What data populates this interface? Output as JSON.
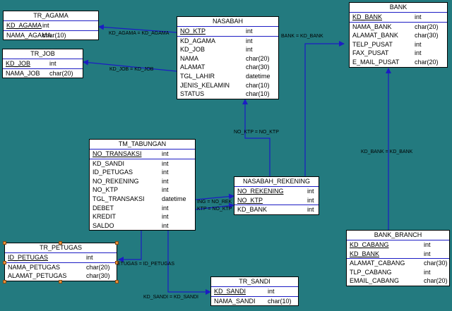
{
  "tables": {
    "tr_agama": {
      "title": "TR_AGAMA",
      "columns": [
        {
          "name": "KD_AGAMA",
          "type": "int",
          "pk": true
        },
        {
          "name": "NAMA_AGAMA",
          "type": "char(10)",
          "pk": false
        }
      ]
    },
    "tr_job": {
      "title": "TR_JOB",
      "columns": [
        {
          "name": "KD_JOB",
          "type": "int",
          "pk": true
        },
        {
          "name": "NAMA_JOB",
          "type": "char(20)",
          "pk": false
        }
      ]
    },
    "nasabah": {
      "title": "NASABAH",
      "columns": [
        {
          "name": "NO_KTP",
          "type": "int",
          "pk": true
        },
        {
          "name": "KD_AGAMA",
          "type": "int",
          "pk": false
        },
        {
          "name": "KD_JOB",
          "type": "int",
          "pk": false
        },
        {
          "name": "NAMA",
          "type": "char(20)",
          "pk": false
        },
        {
          "name": "ALAMAT",
          "type": "char(30)",
          "pk": false
        },
        {
          "name": "TGL_LAHIR",
          "type": "datetime",
          "pk": false
        },
        {
          "name": "JENIS_KELAMIN",
          "type": "char(10)",
          "pk": false
        },
        {
          "name": "STATUS",
          "type": "char(10)",
          "pk": false
        }
      ]
    },
    "bank": {
      "title": "BANK",
      "columns": [
        {
          "name": "KD_BANK",
          "type": "int",
          "pk": true
        },
        {
          "name": "NAMA_BANK",
          "type": "char(20)",
          "pk": false
        },
        {
          "name": "ALAMAT_BANK",
          "type": "char(30)",
          "pk": false
        },
        {
          "name": "TELP_PUSAT",
          "type": "int",
          "pk": false
        },
        {
          "name": "FAX_PUSAT",
          "type": "int",
          "pk": false
        },
        {
          "name": "E_MAIL_PUSAT",
          "type": "char(20)",
          "pk": false
        }
      ]
    },
    "tm_tabungan": {
      "title": "TM_TABUNGAN",
      "columns": [
        {
          "name": "NO_TRANSAKSI",
          "type": "int",
          "pk": true
        },
        {
          "name": "KD_SANDI",
          "type": "int",
          "pk": false
        },
        {
          "name": "ID_PETUGAS",
          "type": "int",
          "pk": false
        },
        {
          "name": "NO_REKENING",
          "type": "int",
          "pk": false
        },
        {
          "name": "NO_KTP",
          "type": "int",
          "pk": false
        },
        {
          "name": "TGL_TRANSAKSI",
          "type": "datetime",
          "pk": false
        },
        {
          "name": "DEBET",
          "type": "int",
          "pk": false
        },
        {
          "name": "KREDIT",
          "type": "int",
          "pk": false
        },
        {
          "name": "SALDO",
          "type": "int",
          "pk": false
        }
      ]
    },
    "nasabah_rekening": {
      "title": "NASABAH_REKENING",
      "columns": [
        {
          "name": "NO_REKENING",
          "type": "int",
          "pk": true
        },
        {
          "name": "NO_KTP",
          "type": "int",
          "pk": true
        },
        {
          "name": "KD_BANK",
          "type": "int",
          "pk": false
        }
      ]
    },
    "bank_branch": {
      "title": "BANK_BRANCH",
      "columns": [
        {
          "name": "KD_CABANG",
          "type": "int",
          "pk": true
        },
        {
          "name": "KD_BANK",
          "type": "int",
          "pk": true
        },
        {
          "name": "ALAMAT_CABANG",
          "type": "char(30)",
          "pk": false
        },
        {
          "name": "TLP_CABANG",
          "type": "int",
          "pk": false
        },
        {
          "name": "EMAIL_CABANG",
          "type": "char(20)",
          "pk": false
        }
      ]
    },
    "tr_petugas": {
      "title": "TR_PETUGAS",
      "columns": [
        {
          "name": "ID_PETUGAS",
          "type": "int",
          "pk": true
        },
        {
          "name": "NAMA_PETUGAS",
          "type": "char(20)",
          "pk": false
        },
        {
          "name": "ALAMAT_PETUGAS",
          "type": "char(30)",
          "pk": false
        }
      ]
    },
    "tr_sandi": {
      "title": "TR_SANDI",
      "columns": [
        {
          "name": "KD_SANDI",
          "type": "int",
          "pk": true
        },
        {
          "name": "NAMA_SANDI",
          "type": "char(10)",
          "pk": false
        }
      ]
    }
  },
  "relationships": {
    "agama": "KD_AGAMA = KD_AGAMA",
    "job": "KD_JOB = KD_JOB",
    "bank": "BANK = KD_BANK",
    "ktp": "NO_KTP = NO_KTP",
    "branch": "KD_BANK = KD_BANK",
    "rek_a": "ING = NO_REK",
    "rek_b": "KTP = NO_KTP",
    "petugas": "ETUGAS = ID_PETUGAS",
    "sandi": "KD_SANDI = KD_SANDI"
  },
  "colors": {
    "background": "#237a7f",
    "line": "#1c1cc4",
    "selection_handle": "#e8913c"
  }
}
